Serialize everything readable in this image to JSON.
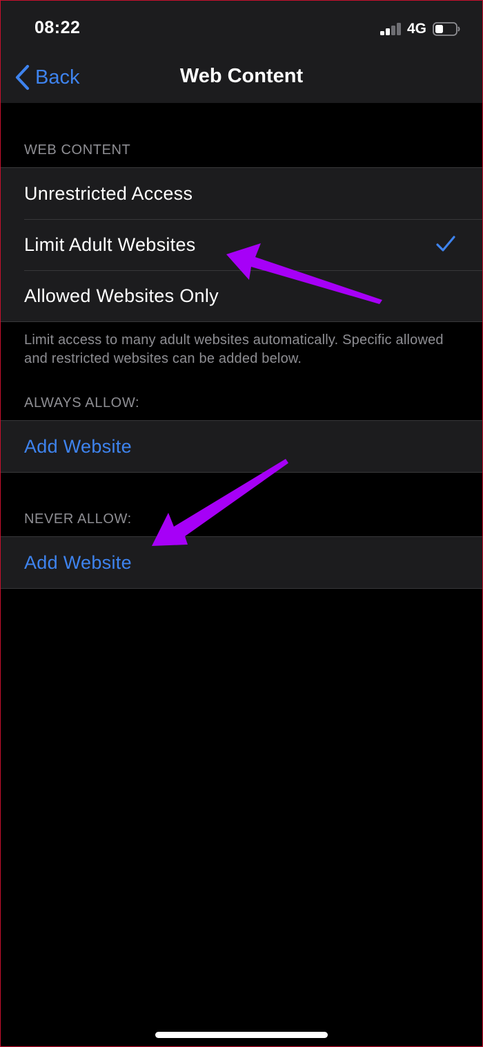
{
  "status_bar": {
    "time": "08:22",
    "network": "4G",
    "signal_icon": "cellular-signal-icon",
    "battery_icon": "battery-icon"
  },
  "nav": {
    "back_label": "Back",
    "back_icon": "chevron-left-icon",
    "title": "Web Content"
  },
  "web_content": {
    "header": "WEB CONTENT",
    "options": [
      {
        "label": "Unrestricted Access",
        "selected": false
      },
      {
        "label": "Limit Adult Websites",
        "selected": true
      },
      {
        "label": "Allowed Websites Only",
        "selected": false
      }
    ],
    "footnote": "Limit access to many adult websites automatically. Specific allowed and restricted websites can be added below."
  },
  "always_allow": {
    "header": "ALWAYS ALLOW:",
    "add_label": "Add Website"
  },
  "never_allow": {
    "header": "NEVER ALLOW:",
    "add_label": "Add Website"
  },
  "colors": {
    "accent": "#3e83ee",
    "annotation_arrow": "#a600f7",
    "background": "#000000",
    "cell": "#1c1c1e",
    "secondary_text": "#8e8e93"
  }
}
